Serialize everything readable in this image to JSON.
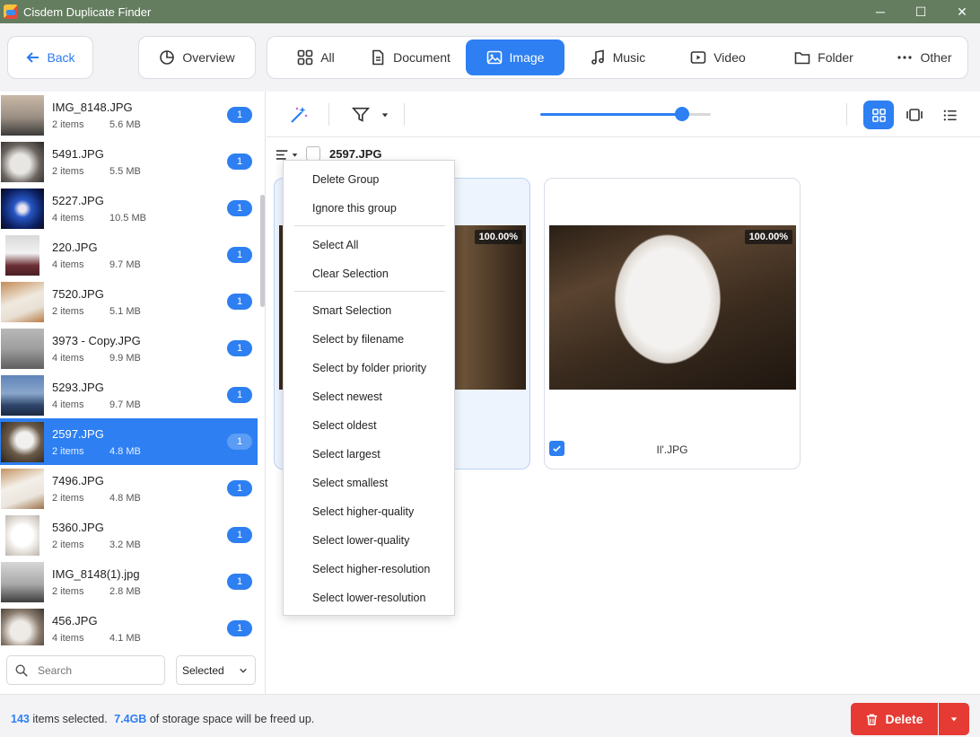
{
  "window": {
    "title": "Cisdem Duplicate Finder",
    "minimize": "─",
    "maximize": "☐",
    "close": "✕"
  },
  "toolbar": {
    "back_label": "Back",
    "overview_label": "Overview",
    "categories": [
      {
        "label": "All",
        "icon": "grid-icon"
      },
      {
        "label": "Document",
        "icon": "document-icon"
      },
      {
        "label": "Image",
        "icon": "image-icon",
        "active": true
      },
      {
        "label": "Music",
        "icon": "music-icon"
      },
      {
        "label": "Video",
        "icon": "video-icon"
      },
      {
        "label": "Folder",
        "icon": "folder-icon"
      },
      {
        "label": "Other",
        "icon": "more-icon"
      }
    ]
  },
  "sidebar": {
    "items": [
      {
        "name": "IMG_8148.JPG",
        "count": "2 items",
        "size": "5.6 MB",
        "badge": "1"
      },
      {
        "name": "5491.JPG",
        "count": "2 items",
        "size": "5.5 MB",
        "badge": "1"
      },
      {
        "name": "5227.JPG",
        "count": "4 items",
        "size": "10.5 MB",
        "badge": "1"
      },
      {
        "name": "220.JPG",
        "count": "4 items",
        "size": "9.7 MB",
        "badge": "1"
      },
      {
        "name": "7520.JPG",
        "count": "2 items",
        "size": "5.1 MB",
        "badge": "1"
      },
      {
        "name": "3973 - Copy.JPG",
        "count": "4 items",
        "size": "9.9 MB",
        "badge": "1"
      },
      {
        "name": "5293.JPG",
        "count": "4 items",
        "size": "9.7 MB",
        "badge": "1"
      },
      {
        "name": "2597.JPG",
        "count": "2 items",
        "size": "4.8 MB",
        "badge": "1",
        "active": true
      },
      {
        "name": "7496.JPG",
        "count": "2 items",
        "size": "4.8 MB",
        "badge": "1"
      },
      {
        "name": "5360.JPG",
        "count": "2 items",
        "size": "3.2 MB",
        "badge": "1"
      },
      {
        "name": "IMG_8148(1).jpg",
        "count": "2 items",
        "size": "2.8 MB",
        "badge": "1"
      },
      {
        "name": "456.JPG",
        "count": "4 items",
        "size": "4.1 MB",
        "badge": "1"
      }
    ],
    "search_placeholder": "Search",
    "filter_value": "Selected"
  },
  "main": {
    "group_title": "2597.JPG",
    "cards": [
      {
        "similarity": "100.00%",
        "filename": "",
        "checked": false
      },
      {
        "similarity": "100.00%",
        "filename": "Il'.JPG",
        "checked": true
      }
    ]
  },
  "context_menu": {
    "items": [
      "Delete Group",
      "Ignore this group",
      "Select All",
      "Clear Selection",
      "Smart Selection",
      "Select by filename",
      "Select by folder priority",
      "Select newest",
      "Select oldest",
      "Select largest",
      "Select smallest",
      "Select higher-quality",
      "Select lower-quality",
      "Select higher-resolution",
      "Select lower-resolution"
    ]
  },
  "slider": {
    "value": 0.83
  },
  "status": {
    "count": "143",
    "count_text": "items selected.",
    "size": "7.4GB",
    "size_text": "of storage space will be freed up."
  },
  "footer": {
    "delete_label": "Delete"
  },
  "colors": {
    "accent": "#2d7ff2",
    "danger": "#e53b34",
    "titlebar": "#647d5f"
  }
}
